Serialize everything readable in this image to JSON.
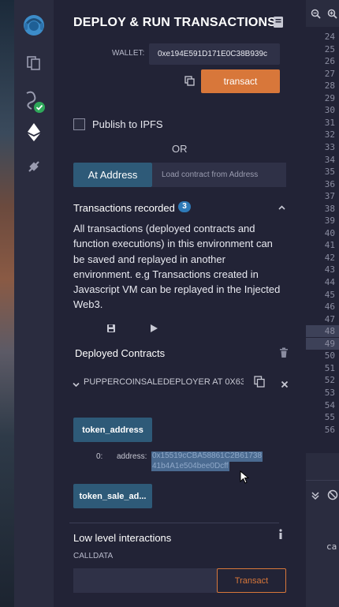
{
  "header": {
    "title": "DEPLOY & RUN TRANSACTIONS"
  },
  "wallet": {
    "label": "WALLET:",
    "address": "0xe194E591D171E0C38B939c"
  },
  "transact_button": "transact",
  "publish": {
    "label": "Publish to IPFS",
    "checked": false
  },
  "or_text": "OR",
  "at_address": {
    "button": "At Address",
    "placeholder": "Load contract from Address"
  },
  "transactions": {
    "title": "Transactions recorded",
    "count": "3",
    "description": "All transactions (deployed contracts and function executions) in this environment can be saved and replayed in another environment. e.g Transactions created in Javascript VM can be replayed in the Injected Web3."
  },
  "deployed": {
    "title": "Deployed Contracts",
    "contract_name": "PUPPERCOINSALEDEPLOYER AT 0X63(",
    "functions": [
      {
        "label": "token_address"
      },
      {
        "label": "token_sale_ad..."
      }
    ],
    "output": {
      "index": "0:",
      "type": "address:",
      "value_line1": "0x15519cCBA58861C2B61738",
      "value_line2": "41b4A1e504bee0Dcff"
    }
  },
  "low_level": {
    "title": "Low level interactions",
    "calldata_label": "CALLDATA",
    "transact_button": "Transact"
  },
  "editor": {
    "line_numbers": [
      "24",
      "25",
      "26",
      "27",
      "28",
      "29",
      "30",
      "31",
      "32",
      "33",
      "34",
      "35",
      "36",
      "37",
      "38",
      "39",
      "40",
      "41",
      "42",
      "43",
      "44",
      "45",
      "46",
      "47",
      "48",
      "49",
      "50",
      "51",
      "52",
      "53",
      "54",
      "55",
      "56"
    ],
    "highlighted": [
      "48",
      "49"
    ],
    "code_fragment": "ca"
  },
  "colors": {
    "panel_bg": "#222336",
    "accent_blue": "#2e5a78",
    "accent_orange": "#d8773a",
    "badge_blue": "#2e7ab8",
    "highlight": "#4a6a90"
  }
}
